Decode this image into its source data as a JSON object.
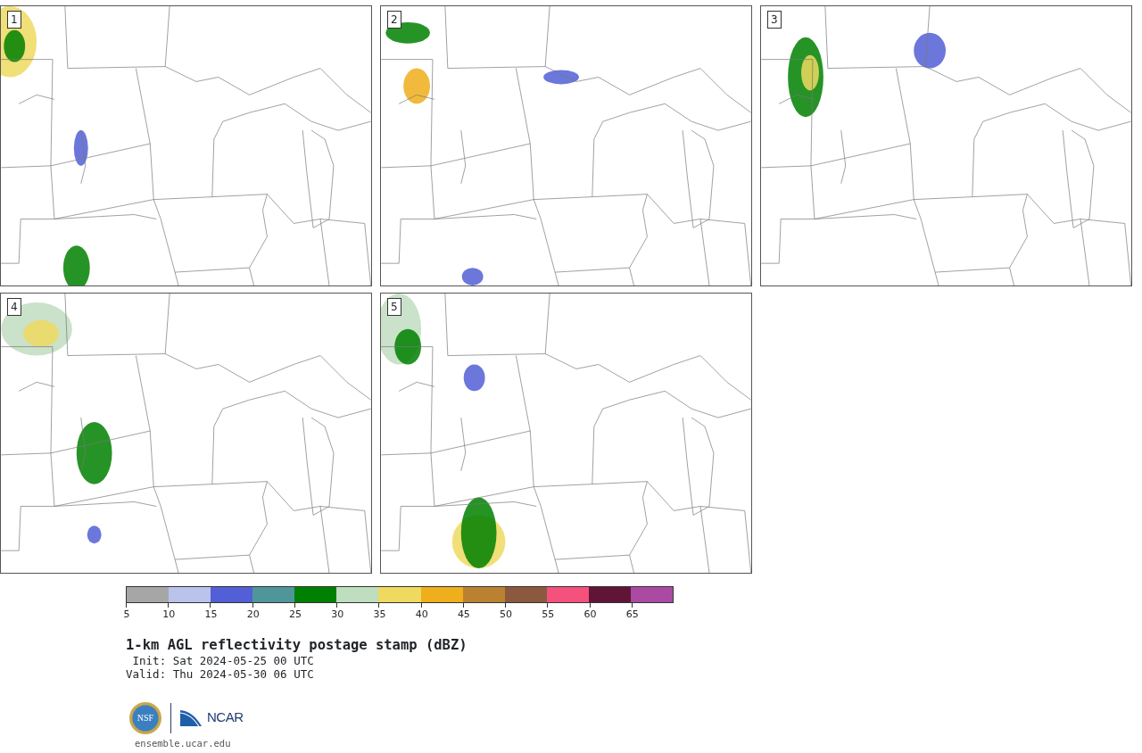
{
  "panels": [
    {
      "label": "1"
    },
    {
      "label": "2"
    },
    {
      "label": "3"
    },
    {
      "label": "4"
    },
    {
      "label": "5"
    }
  ],
  "colorbar": {
    "segments": [
      {
        "color": "#a6a6a6"
      },
      {
        "color": "#b9c3ec"
      },
      {
        "color": "#525fd6"
      },
      {
        "color": "#4f969b"
      },
      {
        "color": "#008000"
      },
      {
        "color": "#bfddbf"
      },
      {
        "color": "#efd95f"
      },
      {
        "color": "#efae1b"
      },
      {
        "color": "#ba8230"
      },
      {
        "color": "#8b5a3e"
      },
      {
        "color": "#f5517d"
      },
      {
        "color": "#611536"
      },
      {
        "color": "#aa4aa3"
      }
    ],
    "ticks": [
      "5",
      "10",
      "15",
      "20",
      "25",
      "30",
      "35",
      "40",
      "45",
      "50",
      "55",
      "60",
      "65"
    ]
  },
  "title": "1-km AGL reflectivity postage stamp (dBZ)",
  "init": " Init: Sat 2024-05-25 00 UTC",
  "valid": "Valid: Thu 2024-05-30 06 UTC",
  "logo": {
    "nsf": "NSF",
    "ncar": "NCAR"
  },
  "url": "ensemble.ucar.edu"
}
